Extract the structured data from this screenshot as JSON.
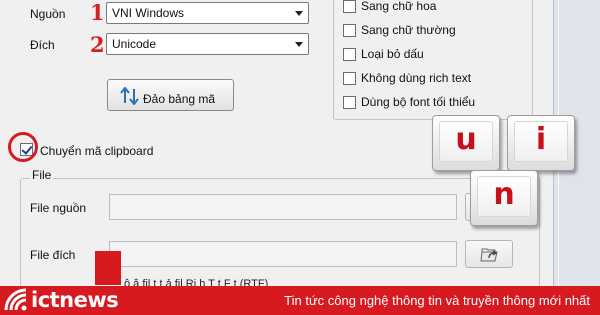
{
  "source": {
    "label": "Nguồn",
    "number": "1",
    "value": "VNI Windows"
  },
  "dest": {
    "label": "Đích",
    "number": "2",
    "value": "Unicode"
  },
  "swap_button": {
    "label": "Đảo bảng mã"
  },
  "options": [
    {
      "label": "Sang chữ hoa",
      "checked": false
    },
    {
      "label": "Sang chữ thường",
      "checked": false
    },
    {
      "label": "Loại bỏ dấu",
      "checked": false
    },
    {
      "label": "Không dùng rich text",
      "checked": false
    },
    {
      "label": "Dùng bộ font tối thiểu",
      "checked": false
    }
  ],
  "clipboard": {
    "label": "Chuyển mã clipboard",
    "checked": true
  },
  "file_group": {
    "title": "File",
    "source_label": "File nguồn",
    "source_value": "",
    "dest_label": "File đích",
    "dest_value": "",
    "truncated_text": "ỗ ằ fil t t ả fil Ri h T t F t (RTF)"
  },
  "keys": [
    "u",
    "i",
    "n"
  ],
  "footer": {
    "brand": "ictnews",
    "tagline": "Tin tức công nghệ thông tin và truyền thông mới nhất",
    "color": "#d71920"
  }
}
